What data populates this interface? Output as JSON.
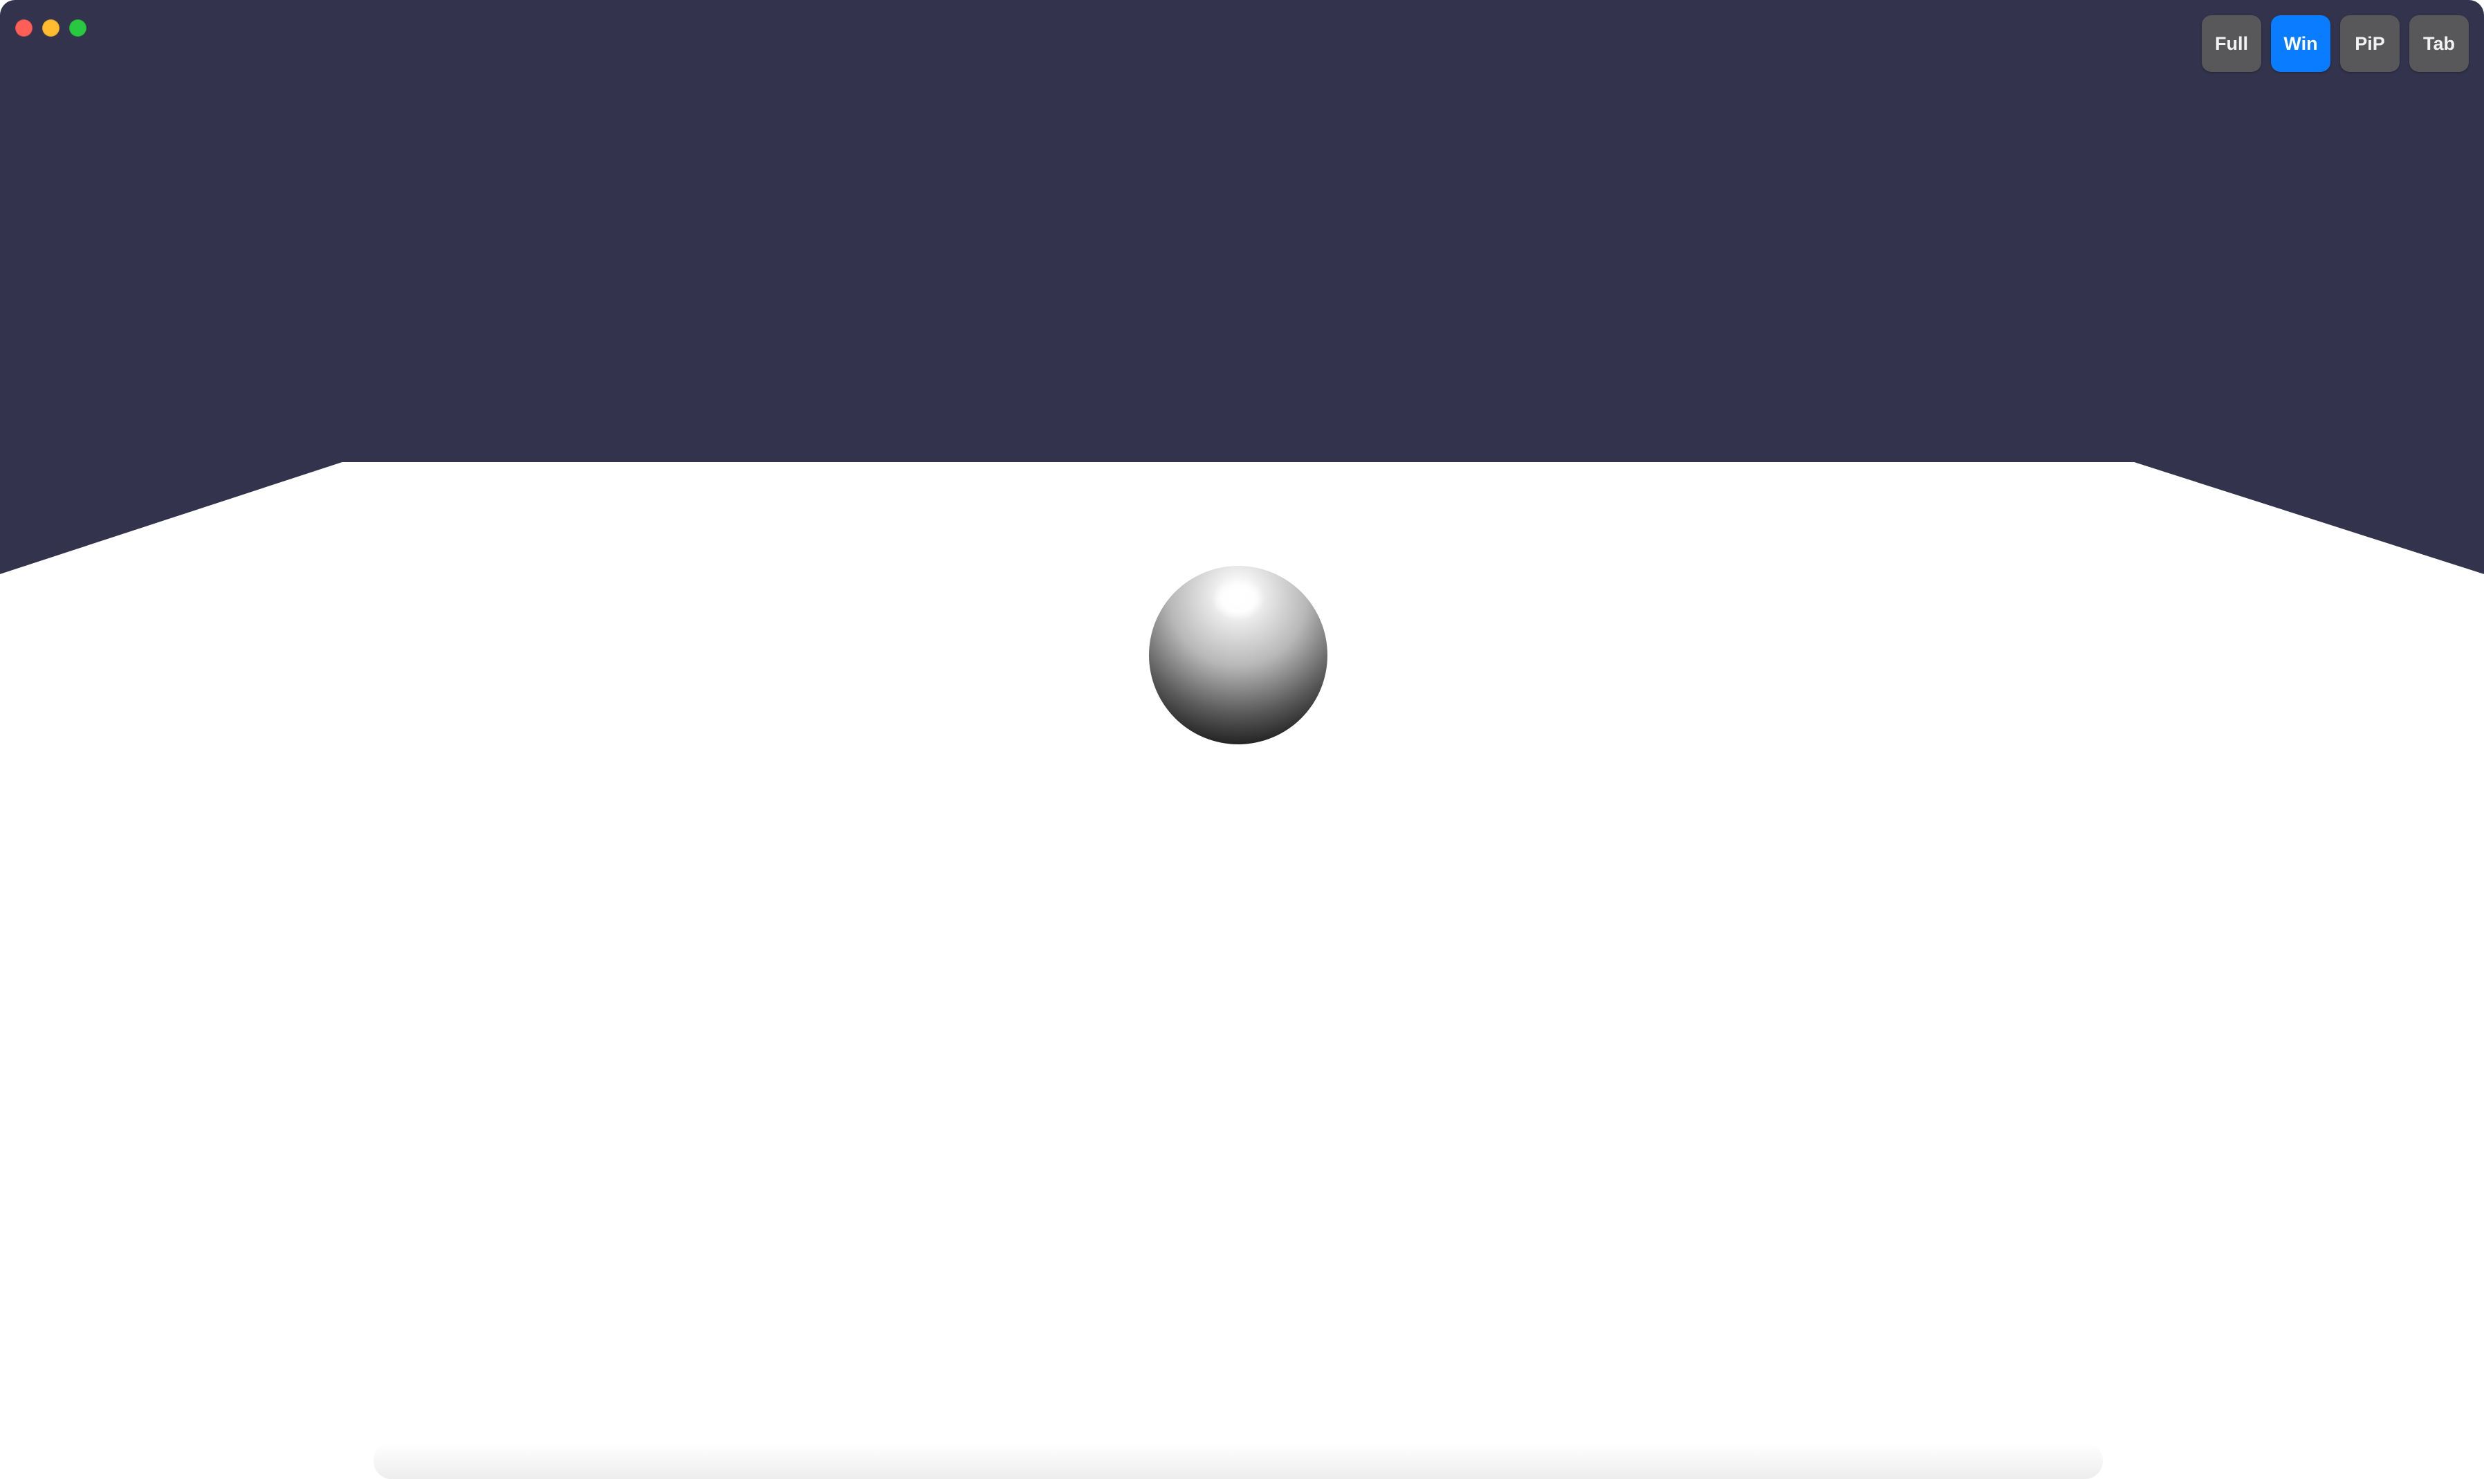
{
  "window": {
    "traffic_lights": [
      "close",
      "minimize",
      "zoom"
    ]
  },
  "colors": {
    "sky": "#33334d",
    "floor": "#ffffff",
    "active_button": "#0a7cff",
    "inactive_button": "#58585b",
    "sphere_light": "#f4f4f4",
    "sphere_dark": "#1a1a1a"
  },
  "mode_toolbar": {
    "buttons": [
      {
        "label": "Full",
        "active": false
      },
      {
        "label": "Win",
        "active": true
      },
      {
        "label": "PiP",
        "active": false
      },
      {
        "label": "Tab",
        "active": false
      }
    ]
  },
  "scene": {
    "objects": [
      "room-floor",
      "back-wall",
      "sphere"
    ]
  }
}
